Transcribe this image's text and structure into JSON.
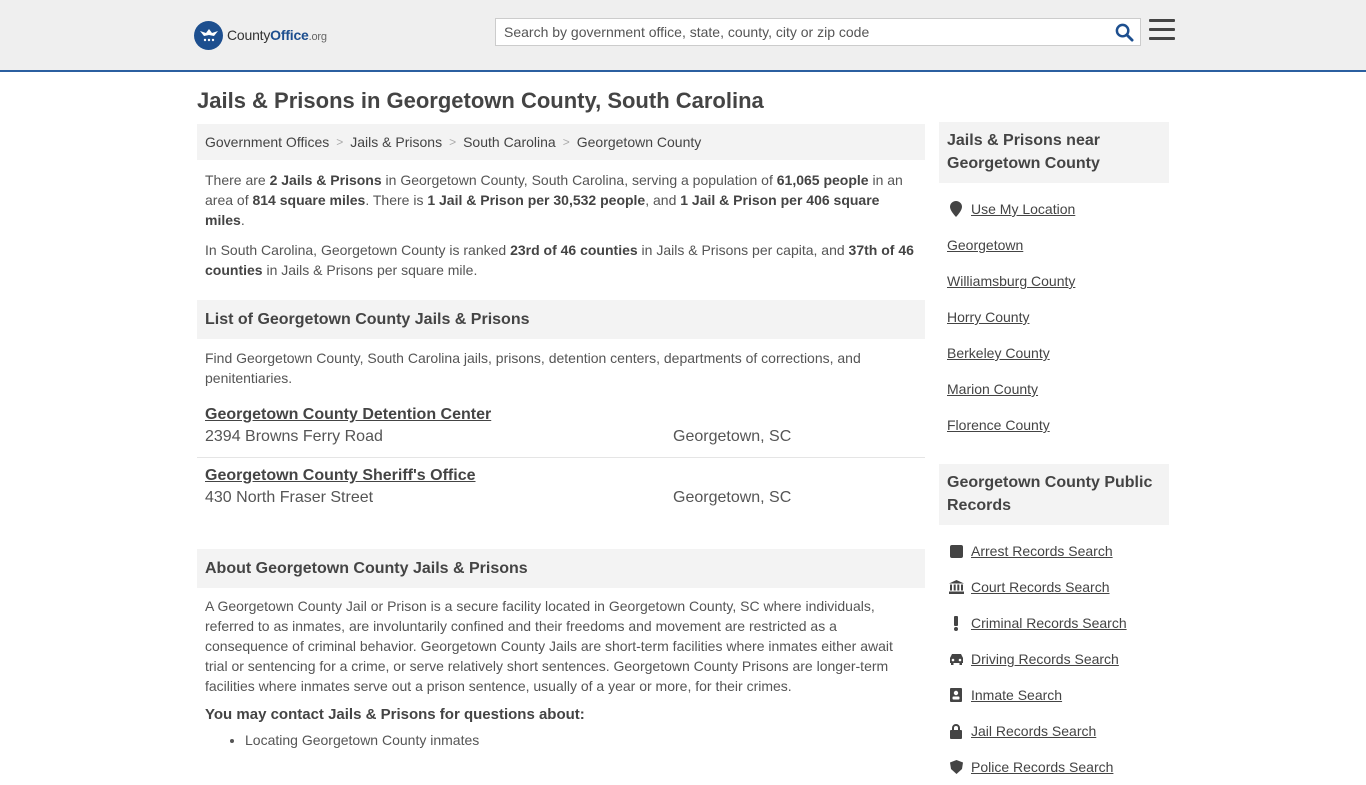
{
  "header": {
    "logo_text_main": "County",
    "logo_text_brand": "Office",
    "logo_text_tld": ".org",
    "search_placeholder": "Search by government office, state, county, city or zip code"
  },
  "page_title": "Jails & Prisons in Georgetown County, South Carolina",
  "breadcrumb": [
    "Government Offices",
    "Jails & Prisons",
    "South Carolina",
    "Georgetown County"
  ],
  "intro": {
    "p1": {
      "t1": "There are ",
      "b1": "2 Jails & Prisons",
      "t2": " in Georgetown County, South Carolina, serving a population of ",
      "b2": "61,065 people",
      "t3": " in an area of ",
      "b3": "814 square miles",
      "t4": ". There is ",
      "b4": "1 Jail & Prison per 30,532 people",
      "t5": ", and ",
      "b5": "1 Jail & Prison per 406 square miles",
      "t6": "."
    },
    "p2": {
      "t1": "In South Carolina, Georgetown County is ranked ",
      "b1": "23rd of 46 counties",
      "t2": " in Jails & Prisons per capita, and ",
      "b2": "37th of 46 counties",
      "t3": " in Jails & Prisons per square mile."
    }
  },
  "list_section": {
    "title": "List of Georgetown County Jails & Prisons",
    "description": "Find Georgetown County, South Carolina jails, prisons, detention centers, departments of corrections, and penitentiaries.",
    "items": [
      {
        "name": "Georgetown County Detention Center",
        "address": "2394 Browns Ferry Road",
        "city": "Georgetown, SC"
      },
      {
        "name": "Georgetown County Sheriff's Office",
        "address": "430 North Fraser Street",
        "city": "Georgetown, SC"
      }
    ]
  },
  "about_section": {
    "title": "About Georgetown County Jails & Prisons",
    "text": "A Georgetown County Jail or Prison is a secure facility located in Georgetown County, SC where individuals, referred to as inmates, are involuntarily confined and their freedoms and movement are restricted as a consequence of criminal behavior. Georgetown County Jails are short-term facilities where inmates either await trial or sentencing for a crime, or serve relatively short sentences. Georgetown County Prisons are longer-term facilities where inmates serve out a prison sentence, usually of a year or more, for their crimes.",
    "contact_heading": "You may contact Jails & Prisons for questions about:",
    "bullets": [
      "Locating Georgetown County inmates"
    ]
  },
  "sidebar": {
    "nearby_title": "Jails & Prisons near Georgetown County",
    "nearby_items": [
      "Use My Location",
      "Georgetown",
      "Williamsburg County",
      "Horry County",
      "Berkeley County",
      "Marion County",
      "Florence County"
    ],
    "records_title": "Georgetown County Public Records",
    "records_items": [
      {
        "label": "Arrest Records Search",
        "icon": "square-icon"
      },
      {
        "label": "Court Records Search",
        "icon": "courthouse-icon"
      },
      {
        "label": "Criminal Records Search",
        "icon": "exclamation-icon"
      },
      {
        "label": "Driving Records Search",
        "icon": "car-icon"
      },
      {
        "label": "Inmate Search",
        "icon": "id-badge-icon"
      },
      {
        "label": "Jail Records Search",
        "icon": "lock-icon"
      },
      {
        "label": "Police Records Search",
        "icon": "shield-icon"
      }
    ]
  },
  "colors": {
    "accent": "#2b5fa0",
    "panel": "#f3f3f3"
  }
}
